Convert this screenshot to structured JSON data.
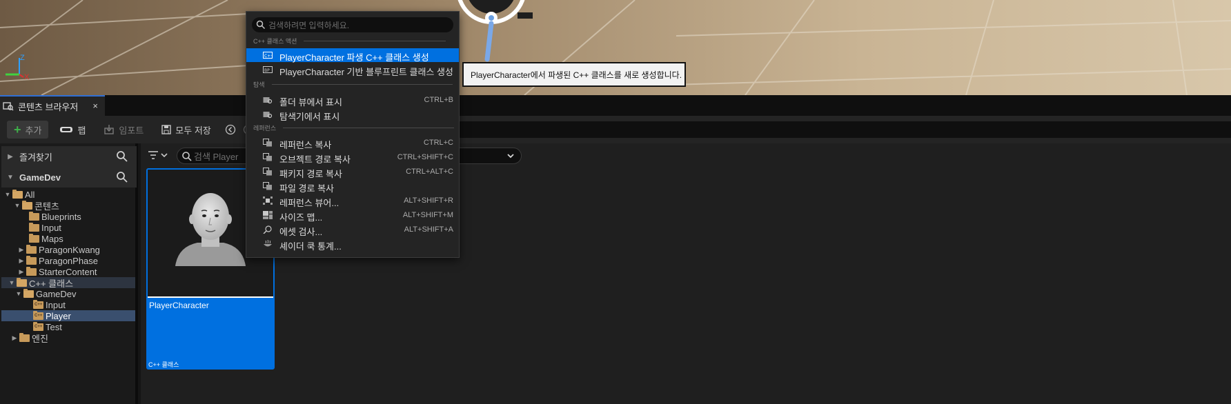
{
  "viewport": {
    "axis_z": "Z",
    "axis_x": "X"
  },
  "content_browser": {
    "tab_title": "콘텐츠 브라우저",
    "close_glyph": "×",
    "toolbar": {
      "add_label": "추가",
      "fab_label": "팹",
      "import_label": "임포트",
      "save_all_label": "모두 저장"
    },
    "favorites_label": "즐겨찾기",
    "project_label": "GameDev",
    "tree": [
      {
        "label": "All",
        "caret": "▼",
        "folder": "open"
      },
      {
        "label": "콘텐츠",
        "caret": "▼",
        "folder": "open"
      },
      {
        "label": "Blueprints",
        "caret": "",
        "folder": "closed"
      },
      {
        "label": "Input",
        "caret": "",
        "folder": "closed"
      },
      {
        "label": "Maps",
        "caret": "",
        "folder": "closed"
      },
      {
        "label": "ParagonKwang",
        "caret": "▶",
        "folder": "closed"
      },
      {
        "label": "ParagonPhase",
        "caret": "▶",
        "folder": "closed"
      },
      {
        "label": "StarterContent",
        "caret": "▶",
        "folder": "closed"
      },
      {
        "label": "C++ 클래스",
        "caret": "▼",
        "folder": "open"
      },
      {
        "label": "GameDev",
        "caret": "▼",
        "folder": "open"
      },
      {
        "label": "Input",
        "caret": "",
        "folder": "cpp"
      },
      {
        "label": "Player",
        "caret": "",
        "folder": "cpp"
      },
      {
        "label": "Test",
        "caret": "",
        "folder": "cpp"
      },
      {
        "label": "엔진",
        "caret": "▶",
        "folder": "closed"
      }
    ],
    "search_placeholder": "검색 Player",
    "asset": {
      "name": "PlayerCharacter",
      "type": "C++ 클래스"
    }
  },
  "context_menu": {
    "search_placeholder": "검색하려면 입력하세요.",
    "sections": {
      "cpp_actions": "C++ 클래스 액션",
      "explore": "탐색",
      "references": "레퍼런스"
    },
    "items": [
      {
        "label": "PlayerCharacter 파생 C++ 클래스 생성",
        "shortcut": ""
      },
      {
        "label": "PlayerCharacter 기반 블루프린트 클래스 생성",
        "shortcut": ""
      },
      {
        "label": "폴더 뷰에서 표시",
        "shortcut": "CTRL+B"
      },
      {
        "label": "탐색기에서 표시",
        "shortcut": ""
      },
      {
        "label": "레퍼런스 복사",
        "shortcut": "CTRL+C"
      },
      {
        "label": "오브젝트 경로 복사",
        "shortcut": "CTRL+SHIFT+C"
      },
      {
        "label": "패키지 경로 복사",
        "shortcut": "CTRL+ALT+C"
      },
      {
        "label": "파일 경로 복사",
        "shortcut": ""
      },
      {
        "label": "레퍼런스 뷰어...",
        "shortcut": "ALT+SHIFT+R"
      },
      {
        "label": "사이즈 맵...",
        "shortcut": "ALT+SHIFT+M"
      },
      {
        "label": "에셋 검사...",
        "shortcut": "ALT+SHIFT+A"
      },
      {
        "label": "셰이더 쿡 통계...",
        "shortcut": ""
      }
    ]
  },
  "tooltip": {
    "text": "PlayerCharacter에서 파생된 C++ 클래스를 새로 생성합니다."
  },
  "colors": {
    "accent_blue": "#0070e0",
    "panel_dark": "#242424",
    "folder": "#c79a5a"
  }
}
